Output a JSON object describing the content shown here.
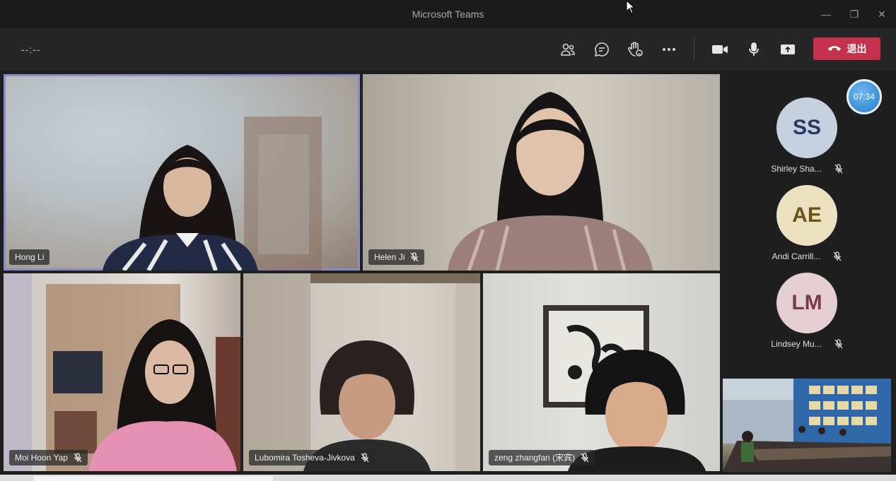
{
  "window": {
    "title": "Microsoft Teams",
    "controls": {
      "minimize": "—",
      "maximize": "❐",
      "close": "✕"
    }
  },
  "toolbar": {
    "timer": "--:--",
    "buttons": [
      {
        "name": "participants",
        "icon": "people-icon"
      },
      {
        "name": "chat",
        "icon": "chat-bubble-icon"
      },
      {
        "name": "reactions",
        "icon": "raise-hand-icon"
      },
      {
        "name": "more",
        "icon": "ellipsis-icon"
      },
      {
        "name": "camera",
        "icon": "video-camera-icon"
      },
      {
        "name": "mic",
        "icon": "microphone-icon"
      },
      {
        "name": "share",
        "icon": "share-screen-icon"
      }
    ],
    "leave_label": "退出",
    "leave_color": "#c4314b"
  },
  "participants": {
    "video_tiles": [
      {
        "name": "Hong Li",
        "muted": false,
        "active_speaker": true
      },
      {
        "name": "Helen Ji",
        "muted": true
      },
      {
        "name": "Moi Hoon Yap",
        "muted": true
      },
      {
        "name": "Lubomira Tosheva-Jivkova",
        "muted": true
      },
      {
        "name": "zeng zhangfan (宋宾)",
        "muted": true
      }
    ],
    "roster": [
      {
        "initials": "SS",
        "name": "Shirley Sha...",
        "muted": true,
        "color": "#c5d0e0",
        "text_color": "#2a3a5e"
      },
      {
        "initials": "AE",
        "name": "Andi Carrill...",
        "muted": true,
        "color": "#ebe1c0",
        "text_color": "#6a5416"
      },
      {
        "initials": "LM",
        "name": "Lindsey Mu...",
        "muted": true,
        "color": "#e6cfd3",
        "text_color": "#7a3a48"
      }
    ],
    "clock_badge": "07:34"
  },
  "colors": {
    "active_outline": "#8b8cc7",
    "background": "#1f1f1f"
  }
}
